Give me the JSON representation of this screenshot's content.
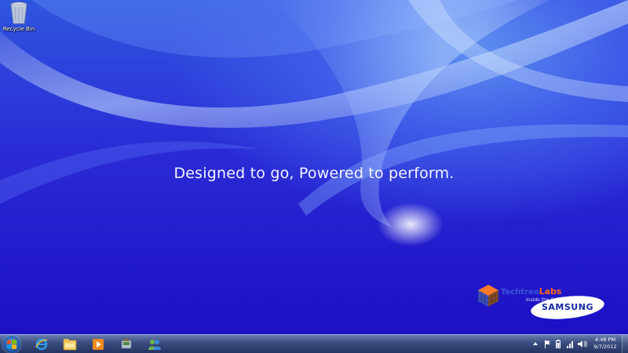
{
  "desktop": {
    "recycle_bin_label": "Recycle Bin",
    "tagline": "Designed to go, Powered to perform."
  },
  "branding": {
    "labs_name_part1": "Techtree",
    "labs_name_part2": "Labs",
    "labs_subtitle": "Inside the Cube",
    "samsung": "SAMSUNG"
  },
  "taskbar": {
    "pinned": [
      {
        "name": "internet-explorer-icon"
      },
      {
        "name": "windows-explorer-icon"
      },
      {
        "name": "media-player-icon"
      },
      {
        "name": "program-icon"
      },
      {
        "name": "network-users-icon"
      }
    ],
    "tray_icons": [
      "show-hidden-icons-icon",
      "action-center-flag-icon",
      "network-signal-icon",
      "battery-icon",
      "volume-icon"
    ],
    "clock_time": "4:48 PM",
    "clock_date": "9/7/2012"
  },
  "colors": {
    "background": "#2a2bd6",
    "taskbar": "#3c4f82",
    "samsung_blue": "#1428a0",
    "labs_orange": "#ff6a1a"
  }
}
